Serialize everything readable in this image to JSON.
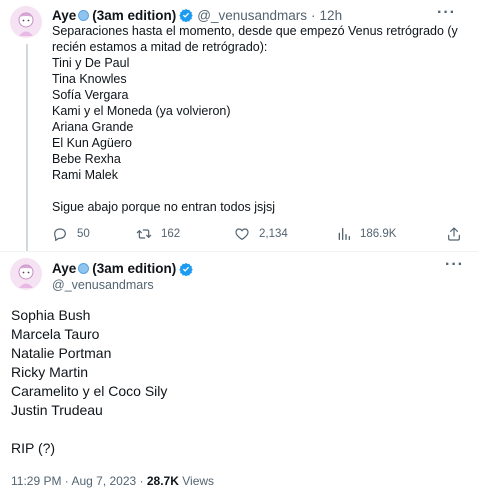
{
  "tweet1": {
    "display_name": "Aye",
    "edition": "(3am edition)",
    "handle": "@_venusandmars",
    "separator": "·",
    "time": "12h",
    "more_label": "···",
    "lines": [
      "Separaciones hasta el momento, desde que empezó Venus retrógrado (y",
      "recién estamos a mitad de retrógrado):",
      "Tini y De Paul",
      "Tina Knowles",
      "Sofía Vergara",
      "Kami y el Moneda (ya volvieron)",
      "Ariana Grande",
      "El Kun Agüero",
      "Bebe Rexha",
      "Rami Malek",
      "",
      "Sigue abajo porque no entran todos jsjsj"
    ],
    "replies": "50",
    "retweets": "162",
    "likes": "2,134",
    "views": "186.9K"
  },
  "tweet2": {
    "display_name": "Aye",
    "edition": "(3am edition)",
    "handle": "@_venusandmars",
    "more_label": "···",
    "lines": [
      "Sophia Bush",
      "Marcela Tauro",
      "Natalie Portman",
      "Ricky Martin",
      "Caramelito y el Coco Sily",
      "Justin Trudeau",
      "",
      "RIP (?)"
    ],
    "timestamp": "11:29 PM · Aug 7, 2023 · ",
    "views_count": "28.7K",
    "views_label": " Views"
  },
  "colors": {
    "verified": "#1d9bf0",
    "muted": "#536471",
    "divider": "#eff3f4",
    "thread_line": "#cfd9de"
  }
}
